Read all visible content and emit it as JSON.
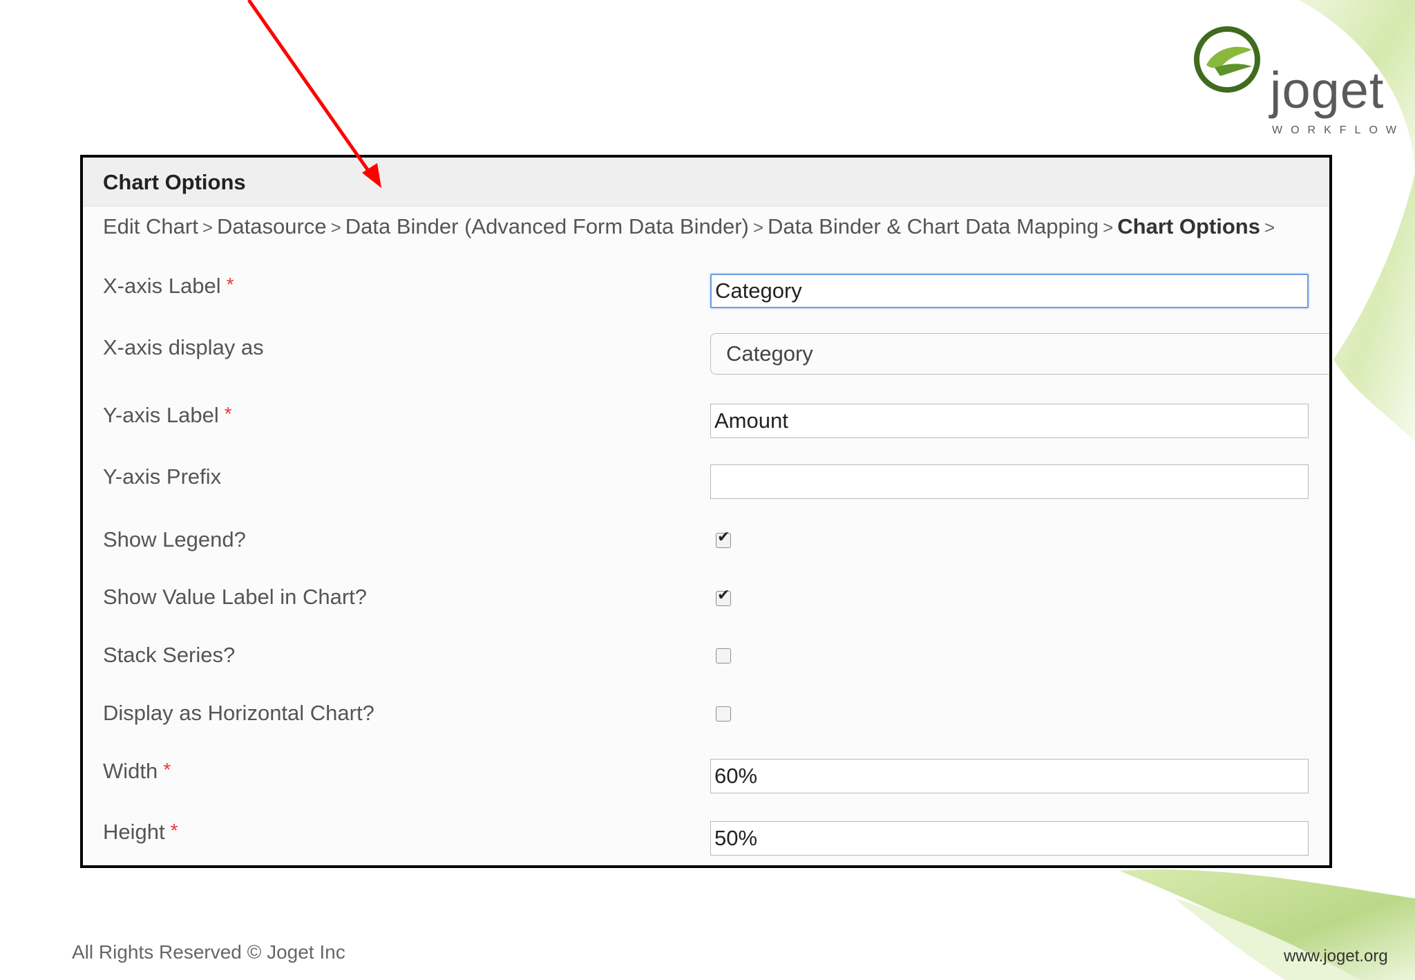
{
  "panel": {
    "title": "Chart Options"
  },
  "breadcrumb": {
    "items": [
      "Edit Chart",
      "Datasource",
      "Data Binder (Advanced Form Data Binder)",
      "Data Binder & Chart Data Mapping",
      "Chart Options"
    ],
    "separator": ">"
  },
  "form": {
    "x_axis_label": {
      "label": "X-axis Label",
      "required": "*",
      "value": "Category"
    },
    "x_axis_display": {
      "label": "X-axis display as",
      "selected": "Category"
    },
    "y_axis_label": {
      "label": "Y-axis Label",
      "required": "*",
      "value": "Amount"
    },
    "y_axis_prefix": {
      "label": "Y-axis Prefix",
      "value": ""
    },
    "show_legend": {
      "label": "Show Legend?",
      "checked": true
    },
    "show_value_label": {
      "label": "Show Value Label in Chart?",
      "checked": true
    },
    "stack_series": {
      "label": "Stack Series?",
      "checked": false
    },
    "horizontal": {
      "label": "Display as Horizontal Chart?",
      "checked": false
    },
    "width": {
      "label": "Width",
      "required": "*",
      "value": "60%"
    },
    "height": {
      "label": "Height",
      "required": "*",
      "value": "50%"
    }
  },
  "brand": {
    "name": "joget",
    "tagline": "WORKFLOW",
    "accent_color": "#5a8c2a"
  },
  "footer": {
    "copyright": "All Rights Reserved © Joget Inc",
    "url": "www.joget.org"
  },
  "colors": {
    "annotation_arrow": "#ff0000",
    "required_star": "#e53935",
    "focus_border": "#6d9cde"
  }
}
